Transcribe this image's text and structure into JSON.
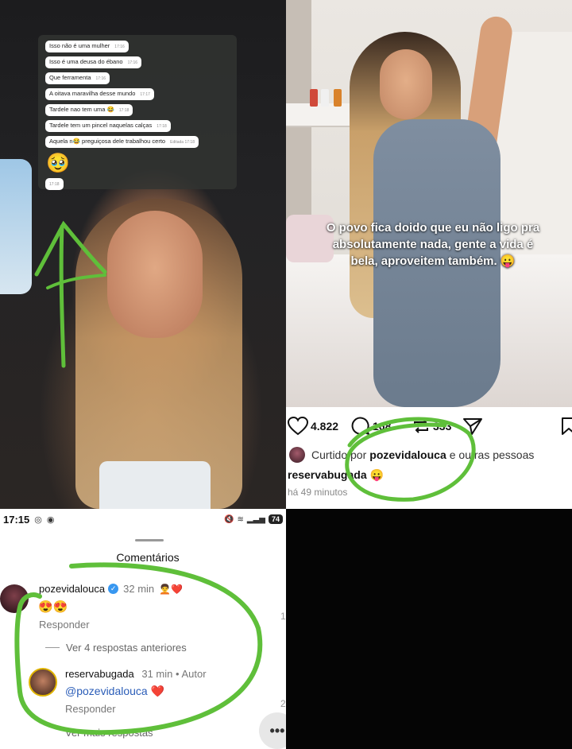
{
  "chat": {
    "messages": [
      {
        "text": "Isso não é uma mulher",
        "time": "17:16"
      },
      {
        "text": "Isso é uma deusa do ébano",
        "time": "17:16"
      },
      {
        "text": "Que ferramenta",
        "time": "17:16"
      },
      {
        "text": "A oitava maravilha desse mundo",
        "time": "17:17"
      },
      {
        "text": "Tardele nao tem uma 😂",
        "time": "17:18"
      },
      {
        "text": "Tardele tem um pincel naquelas calças",
        "time": "17:18"
      },
      {
        "text": "Aquela n😂 preguiçosa dele trabalhou certo",
        "time": "Editada 17:18"
      }
    ],
    "emoji": "🥹",
    "emoji_time": "17:18"
  },
  "post": {
    "overlay_text": "O povo fica doido que eu não ligo pra absolutamente nada, gente a vida é bela, aproveitem também. 😛",
    "likes": "4.822",
    "comments": "168",
    "reposts": "333",
    "liked_by_prefix": "Curtido por",
    "liked_by_user": "pozevidalouca",
    "liked_by_suffix": "e outras pessoas",
    "caption_user": "reservabugada",
    "caption_text": "😛",
    "time_ago": "há 49 minutos"
  },
  "status_bar": {
    "time": "17:15",
    "battery": "74"
  },
  "comments_sheet": {
    "title": "Comentários",
    "comment1": {
      "user": "pozevidalouca",
      "time": "32 min",
      "text": "😍😍",
      "reply_label": "Responder"
    },
    "more_replies": "Ver 4 respostas anteriores",
    "comment2": {
      "user": "reservabugada",
      "time": "31 min",
      "author_badge": "Autor",
      "mention": "@pozevidalouca",
      "text_emoji": "❤️",
      "reply_label": "Responder"
    },
    "footer_more": "Ver mais respostas",
    "side_counts": [
      "1",
      "2"
    ]
  },
  "colors": {
    "annotation_green": "#5fbf3a",
    "verified_blue": "#3897f0",
    "mention_blue": "#2b5db8"
  }
}
